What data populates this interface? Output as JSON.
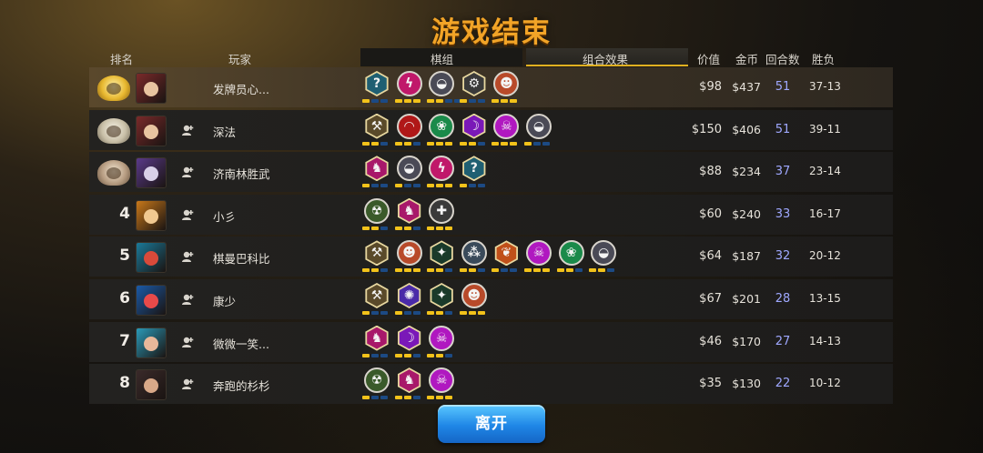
{
  "title": "游戏结束",
  "headers": {
    "rank": "排名",
    "player": "玩家",
    "synergies": "棋组",
    "combo_effect": "组合效果",
    "value": "价值",
    "gold": "金币",
    "rounds": "回合数",
    "win_loss": "胜负"
  },
  "rows": [
    {
      "rank": "",
      "medal": "gold",
      "name": "发牌员心...",
      "value": "$98",
      "gold": "$437",
      "rounds": "51",
      "wl": "37-13",
      "avatar_colors": [
        "#7a2a2a",
        "#e8c4a0"
      ],
      "add_friend": false,
      "traits": [
        {
          "icon": "question-icon",
          "glyph": "?",
          "bg": "#1f5f72",
          "shape": "hex",
          "pips": [
            1,
            0,
            0
          ]
        },
        {
          "icon": "bolt-icon",
          "glyph": "ϟ",
          "bg": "#c0186a",
          "shape": "circle",
          "pips": [
            1,
            1,
            1
          ]
        },
        {
          "icon": "helmet-icon",
          "glyph": "◒",
          "bg": "#4a4a56",
          "shape": "circle",
          "pips": [
            1,
            1,
            0,
            0
          ]
        },
        {
          "icon": "gear-icon",
          "glyph": "⚙",
          "bg": "#3a3a3a",
          "shape": "hex",
          "pips": [
            1,
            0,
            0
          ]
        },
        {
          "icon": "demon-icon",
          "glyph": "☻",
          "bg": "#b84a2a",
          "shape": "circle",
          "pips": [
            1,
            1,
            1
          ]
        }
      ]
    },
    {
      "rank": "",
      "medal": "silver",
      "name": "深法",
      "value": "$150",
      "gold": "$406",
      "rounds": "51",
      "wl": "39-11",
      "avatar_colors": [
        "#7a2a2a",
        "#e8c4a0"
      ],
      "add_friend": true,
      "traits": [
        {
          "icon": "axe-icon",
          "glyph": "⚒",
          "bg": "#5a4a2a",
          "shape": "hex",
          "pips": [
            1,
            1,
            0
          ]
        },
        {
          "icon": "arc-icon",
          "glyph": "◠",
          "bg": "#b01818",
          "shape": "circle",
          "pips": [
            1,
            1,
            0
          ]
        },
        {
          "icon": "paw-icon",
          "glyph": "❀",
          "bg": "#1a8a4a",
          "shape": "circle",
          "pips": [
            1,
            1,
            1
          ]
        },
        {
          "icon": "wraith-icon",
          "glyph": "☽",
          "bg": "#7a18b8",
          "shape": "hex",
          "pips": [
            1,
            1,
            0
          ]
        },
        {
          "icon": "skull-icon",
          "glyph": "☠",
          "bg": "#b018c0",
          "shape": "circle",
          "pips": [
            1,
            1,
            1
          ]
        },
        {
          "icon": "helmet-icon",
          "glyph": "◒",
          "bg": "#4a4a56",
          "shape": "circle",
          "pips": [
            1,
            0,
            0
          ]
        }
      ]
    },
    {
      "rank": "",
      "medal": "bronze",
      "name": "济南林胜武",
      "value": "$88",
      "gold": "$234",
      "rounds": "37",
      "wl": "23-14",
      "avatar_colors": [
        "#5a3a8a",
        "#d8d0e8"
      ],
      "add_friend": true,
      "traits": [
        {
          "icon": "knight-icon",
          "glyph": "♞",
          "bg": "#a8186a",
          "shape": "hex",
          "pips": [
            1,
            0,
            0
          ]
        },
        {
          "icon": "helmet-icon",
          "glyph": "◒",
          "bg": "#4a4a56",
          "shape": "circle",
          "pips": [
            1,
            0,
            0
          ]
        },
        {
          "icon": "bolt-icon",
          "glyph": "ϟ",
          "bg": "#c0186a",
          "shape": "circle",
          "pips": [
            1,
            1,
            1
          ]
        },
        {
          "icon": "question-icon",
          "glyph": "?",
          "bg": "#1f5f72",
          "shape": "hex",
          "pips": [
            1,
            0,
            0
          ]
        }
      ]
    },
    {
      "rank": "4",
      "medal": "",
      "name": "小彡",
      "value": "$60",
      "gold": "$240",
      "rounds": "33",
      "wl": "16-17",
      "avatar_colors": [
        "#c8781a",
        "#f0c890"
      ],
      "add_friend": true,
      "traits": [
        {
          "icon": "goblin-icon",
          "glyph": "☢",
          "bg": "#3a5a2a",
          "shape": "circle",
          "pips": [
            1,
            1,
            0
          ]
        },
        {
          "icon": "knight-icon",
          "glyph": "♞",
          "bg": "#a8186a",
          "shape": "hex",
          "pips": [
            1,
            1,
            0
          ]
        },
        {
          "icon": "cross-icon",
          "glyph": "✚",
          "bg": "#3a3a3a",
          "shape": "circle",
          "pips": [
            1,
            1,
            1
          ]
        }
      ]
    },
    {
      "rank": "5",
      "medal": "",
      "name": "棋曼巴科比",
      "value": "$64",
      "gold": "$187",
      "rounds": "32",
      "wl": "20-12",
      "avatar_colors": [
        "#1a7a9a",
        "#d84a3a"
      ],
      "add_friend": true,
      "traits": [
        {
          "icon": "axe-icon",
          "glyph": "⚒",
          "bg": "#5a4a2a",
          "shape": "hex",
          "pips": [
            1,
            1,
            0
          ]
        },
        {
          "icon": "demon-icon",
          "glyph": "☻",
          "bg": "#b84a2a",
          "shape": "circle",
          "pips": [
            1,
            1,
            1
          ]
        },
        {
          "icon": "hunter-icon",
          "glyph": "✦",
          "bg": "#1a3a2a",
          "shape": "hex",
          "pips": [
            1,
            1,
            0
          ]
        },
        {
          "icon": "peasant-icon",
          "glyph": "⁂",
          "bg": "#3a4a5a",
          "shape": "circle",
          "pips": [
            1,
            1,
            0
          ]
        },
        {
          "icon": "feather-icon",
          "glyph": "❦",
          "bg": "#c0501a",
          "shape": "hex",
          "pips": [
            1,
            0,
            0
          ]
        },
        {
          "icon": "skull-icon",
          "glyph": "☠",
          "bg": "#b018c0",
          "shape": "circle",
          "pips": [
            1,
            1,
            1
          ]
        },
        {
          "icon": "paw-icon",
          "glyph": "❀",
          "bg": "#1a8a4a",
          "shape": "circle",
          "pips": [
            1,
            1,
            0
          ]
        },
        {
          "icon": "helmet-icon",
          "glyph": "◒",
          "bg": "#4a4a56",
          "shape": "circle",
          "pips": [
            1,
            1,
            0
          ]
        }
      ]
    },
    {
      "rank": "6",
      "medal": "",
      "name": "康少",
      "value": "$67",
      "gold": "$201",
      "rounds": "28",
      "wl": "13-15",
      "avatar_colors": [
        "#1a5aa8",
        "#e84a4a"
      ],
      "add_friend": true,
      "traits": [
        {
          "icon": "axe-icon",
          "glyph": "⚒",
          "bg": "#5a4a2a",
          "shape": "hex",
          "pips": [
            1,
            0,
            0
          ]
        },
        {
          "icon": "fishbone-icon",
          "glyph": "✺",
          "bg": "#4a2aa8",
          "shape": "hex",
          "pips": [
            1,
            0,
            0
          ]
        },
        {
          "icon": "hunter-icon",
          "glyph": "✦",
          "bg": "#1a3a2a",
          "shape": "hex",
          "pips": [
            1,
            1,
            0
          ]
        },
        {
          "icon": "demon-icon",
          "glyph": "☻",
          "bg": "#b84a2a",
          "shape": "circle",
          "pips": [
            1,
            1,
            1
          ]
        }
      ]
    },
    {
      "rank": "7",
      "medal": "",
      "name": "微微一笑...",
      "value": "$46",
      "gold": "$170",
      "rounds": "27",
      "wl": "14-13",
      "avatar_colors": [
        "#2a9ab8",
        "#e8b89a"
      ],
      "add_friend": true,
      "traits": [
        {
          "icon": "knight-icon",
          "glyph": "♞",
          "bg": "#a8186a",
          "shape": "hex",
          "pips": [
            1,
            0,
            0
          ]
        },
        {
          "icon": "wraith-icon",
          "glyph": "☽",
          "bg": "#7a18b8",
          "shape": "hex",
          "pips": [
            1,
            1,
            0
          ]
        },
        {
          "icon": "skull-icon",
          "glyph": "☠",
          "bg": "#b018c0",
          "shape": "circle",
          "pips": [
            1,
            1,
            0
          ]
        }
      ]
    },
    {
      "rank": "8",
      "medal": "",
      "name": "奔跑的杉杉",
      "value": "$35",
      "gold": "$130",
      "rounds": "22",
      "wl": "10-12",
      "avatar_colors": [
        "#3a2a2a",
        "#d8a888"
      ],
      "add_friend": true,
      "traits": [
        {
          "icon": "goblin-icon",
          "glyph": "☢",
          "bg": "#3a5a2a",
          "shape": "circle",
          "pips": [
            1,
            0,
            0
          ]
        },
        {
          "icon": "knight-icon",
          "glyph": "♞",
          "bg": "#a8186a",
          "shape": "hex",
          "pips": [
            1,
            1,
            0
          ]
        },
        {
          "icon": "skull-icon",
          "glyph": "☠",
          "bg": "#b018c0",
          "shape": "circle",
          "pips": [
            1,
            1,
            1
          ]
        }
      ]
    }
  ],
  "leave_button": "离开"
}
